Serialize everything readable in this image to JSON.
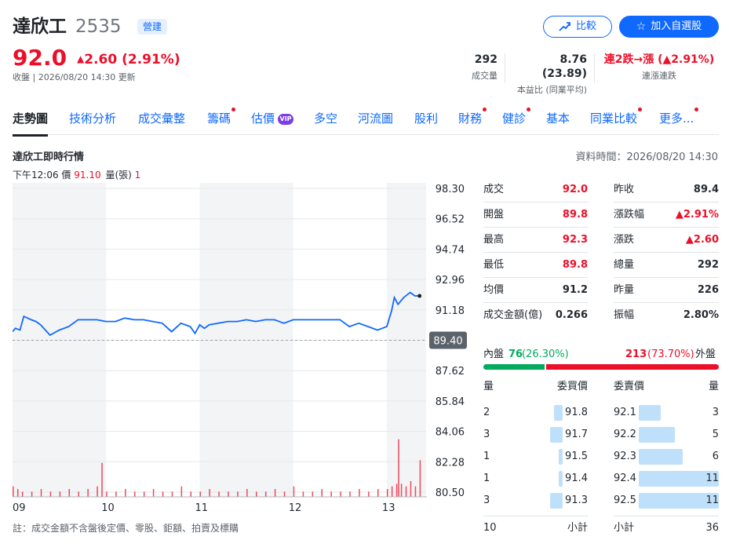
{
  "header": {
    "name": "達欣工",
    "code": "2535",
    "badge": "營建",
    "price": "92.0",
    "change": "2.60 (2.91%)",
    "meta": "收盤 | 2026/08/20 14:30 更新",
    "compare_label": "比較",
    "watch_label": "加入自選股",
    "stats": [
      {
        "value": "292",
        "label": "成交量"
      },
      {
        "value": "8.76 (23.89)",
        "label": "本益比 (同業平均)"
      },
      {
        "value": "連2跌→漲 (▲2.91%)",
        "label": "連漲連跌"
      }
    ]
  },
  "tabs": [
    {
      "label": "走勢圖",
      "dot": false
    },
    {
      "label": "技術分析",
      "dot": false
    },
    {
      "label": "成交彙整",
      "dot": false
    },
    {
      "label": "籌碼",
      "dot": true
    },
    {
      "label": "估價",
      "dot": false,
      "vip": "VIP"
    },
    {
      "label": "多空",
      "dot": false
    },
    {
      "label": "河流圖",
      "dot": false
    },
    {
      "label": "股利",
      "dot": false
    },
    {
      "label": "財務",
      "dot": true
    },
    {
      "label": "健診",
      "dot": true
    },
    {
      "label": "基本",
      "dot": false
    },
    {
      "label": "同業比較",
      "dot": true
    },
    {
      "label": "更多...",
      "dot": true
    }
  ],
  "section": {
    "title": "達欣工即時行情",
    "data_time": "資料時間：2026/08/20 14:30",
    "tick_time": "下午12:06",
    "tick_price_label": "價",
    "tick_price": "91.10",
    "tick_vol_label": "量(張)",
    "tick_vol": "1"
  },
  "chart_data": {
    "type": "line",
    "title": "",
    "x_ticks": [
      "09",
      "10",
      "11",
      "12",
      "13"
    ],
    "y_ticks": [
      98.3,
      96.52,
      94.74,
      92.96,
      91.18,
      89.4,
      87.62,
      85.84,
      84.06,
      82.28,
      80.5
    ],
    "ylim": [
      80.5,
      98.3
    ],
    "reference_price": 89.4,
    "reference_label": "89.40",
    "price_series": {
      "x_hours": [
        9.0,
        9.03,
        9.08,
        9.12,
        9.16,
        9.2,
        9.25,
        9.3,
        9.4,
        9.5,
        9.6,
        9.7,
        9.8,
        9.9,
        10.0,
        10.1,
        10.2,
        10.3,
        10.4,
        10.5,
        10.6,
        10.7,
        10.8,
        10.9,
        10.95,
        11.0,
        11.05,
        11.1,
        11.2,
        11.3,
        11.4,
        11.5,
        11.6,
        11.7,
        11.8,
        11.9,
        12.0,
        12.1,
        12.2,
        12.3,
        12.4,
        12.5,
        12.6,
        12.7,
        12.8,
        12.9,
        12.95,
        13.0,
        13.05,
        13.08,
        13.12,
        13.18,
        13.25,
        13.3,
        13.35
      ],
      "price": [
        89.9,
        90.1,
        90.0,
        90.8,
        90.7,
        90.6,
        90.5,
        90.3,
        89.7,
        90.0,
        90.2,
        90.6,
        90.6,
        90.6,
        90.5,
        90.5,
        90.7,
        90.6,
        90.6,
        90.5,
        90.4,
        89.9,
        90.4,
        90.2,
        89.8,
        90.3,
        90.1,
        90.3,
        90.4,
        90.5,
        90.5,
        90.6,
        90.5,
        90.6,
        90.6,
        90.4,
        90.6,
        90.6,
        90.6,
        90.6,
        90.6,
        90.6,
        90.2,
        90.4,
        90.2,
        90.0,
        90.1,
        90.2,
        91.1,
        91.9,
        91.5,
        91.9,
        92.2,
        92.0,
        92.0
      ]
    },
    "volume_series": {
      "x_hours": [
        9.0,
        9.05,
        9.1,
        9.2,
        9.3,
        9.4,
        9.5,
        9.6,
        9.7,
        9.8,
        9.9,
        9.95,
        10.0,
        10.1,
        10.2,
        10.3,
        10.4,
        10.5,
        10.6,
        10.7,
        10.8,
        10.9,
        11.0,
        11.1,
        11.2,
        11.3,
        11.4,
        11.5,
        11.6,
        11.7,
        11.8,
        11.9,
        12.0,
        12.1,
        12.2,
        12.3,
        12.4,
        12.5,
        12.6,
        12.7,
        12.8,
        12.9,
        13.0,
        13.05,
        13.1,
        13.12,
        13.15,
        13.2,
        13.25,
        13.3,
        13.35
      ],
      "volume": [
        4,
        3,
        2,
        2,
        3,
        2,
        2,
        3,
        2,
        3,
        4,
        13,
        2,
        2,
        3,
        2,
        2,
        3,
        2,
        2,
        4,
        2,
        2,
        3,
        2,
        2,
        2,
        3,
        2,
        2,
        3,
        2,
        4,
        2,
        2,
        3,
        2,
        2,
        2,
        3,
        2,
        3,
        3,
        4,
        5,
        22,
        5,
        4,
        6,
        4,
        14
      ]
    }
  },
  "quote": {
    "left": [
      {
        "label": "成交",
        "value": "92.0",
        "color": "red"
      },
      {
        "label": "開盤",
        "value": "89.8",
        "color": "red"
      },
      {
        "label": "最高",
        "value": "92.3",
        "color": "red"
      },
      {
        "label": "最低",
        "value": "89.8",
        "color": "red"
      },
      {
        "label": "均價",
        "value": "91.2",
        "color": "black"
      },
      {
        "label": "成交金額(億)",
        "value": "0.266",
        "color": "black"
      }
    ],
    "right": [
      {
        "label": "昨收",
        "value": "89.4",
        "color": "black"
      },
      {
        "label": "漲跌幅",
        "value": "▲2.91%",
        "color": "red"
      },
      {
        "label": "漲跌",
        "value": "▲2.60",
        "color": "red"
      },
      {
        "label": "總量",
        "value": "292",
        "color": "black"
      },
      {
        "label": "昨量",
        "value": "226",
        "color": "black"
      },
      {
        "label": "振幅",
        "value": "2.80%",
        "color": "black"
      }
    ]
  },
  "orderbook": {
    "inner_label": "內盤",
    "inner_value": "76",
    "inner_pct": "(26.30%)",
    "outer_label": "外盤",
    "outer_value": "213",
    "outer_pct": "(73.70%)",
    "inner_ratio": 0.263,
    "header": {
      "qty": "量",
      "bid": "委買價",
      "ask": "委賣價",
      "qty2": "量"
    },
    "bids": [
      {
        "qty": "2",
        "price": "91.8",
        "n": 2
      },
      {
        "qty": "3",
        "price": "91.7",
        "n": 3
      },
      {
        "qty": "1",
        "price": "91.5",
        "n": 1
      },
      {
        "qty": "1",
        "price": "91.4",
        "n": 1
      },
      {
        "qty": "3",
        "price": "91.3",
        "n": 3
      }
    ],
    "asks": [
      {
        "price": "92.1",
        "qty": "3",
        "n": 3
      },
      {
        "price": "92.2",
        "qty": "5",
        "n": 5
      },
      {
        "price": "92.3",
        "qty": "6",
        "n": 6
      },
      {
        "price": "92.4",
        "qty": "11",
        "n": 11
      },
      {
        "price": "92.5",
        "qty": "11",
        "n": 11
      }
    ],
    "bid_total": "10",
    "ask_total": "36",
    "subtotal_label": "小計"
  },
  "note": "註：成交金額不含盤後定價、零股、鉅額、拍賣及標購"
}
